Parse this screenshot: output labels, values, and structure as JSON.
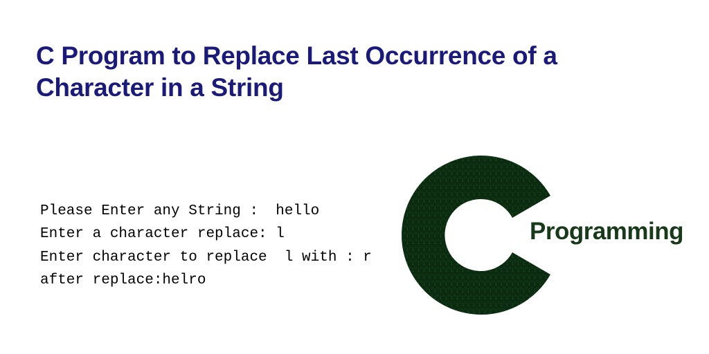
{
  "heading": "C Program to Replace Last Occurrence of a Character in a String",
  "terminal": {
    "line1": "Please Enter any String :  hello",
    "line2": "Enter a character replace: l",
    "line3": "Enter character to replace  l with : r",
    "line4": "after replace:helro"
  },
  "logo": {
    "letter": "C",
    "label": "Programming",
    "color": "#0f2e14"
  }
}
